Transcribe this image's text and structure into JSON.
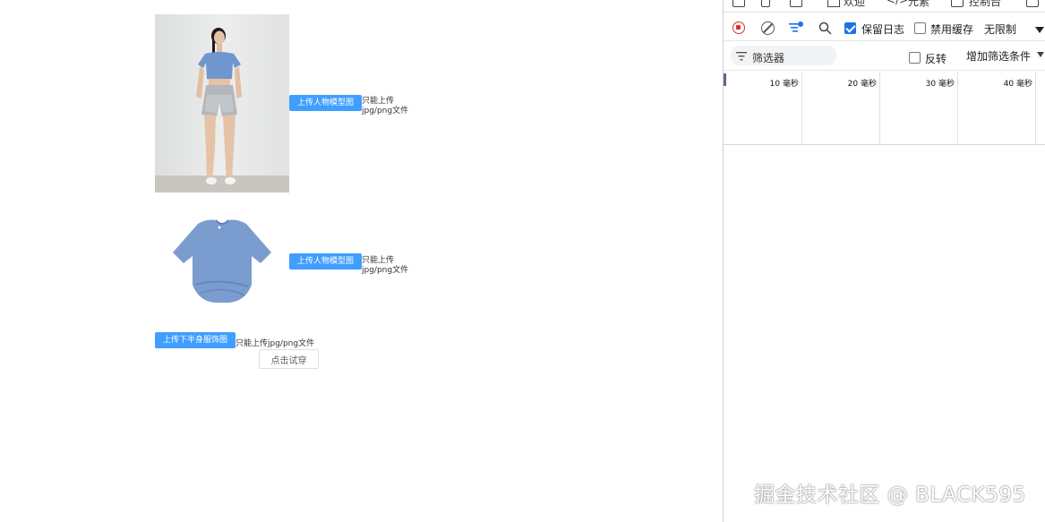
{
  "app": {
    "upload_model": {
      "button_label": "上传人物模型图",
      "tip_line1": "只能上传",
      "tip_line2": "jpg/png文件"
    },
    "upload_top": {
      "button_label": "上传人物模型图",
      "tip_line1": "只能上传",
      "tip_line2": "jpg/png文件"
    },
    "upload_bottom": {
      "button_label": "上传下半身服饰图",
      "tip": "只能上传jpg/png文件"
    },
    "try_on_label": "点击试穿"
  },
  "devtools": {
    "tabs": [
      {
        "label": "欢迎",
        "icon": "home-icon"
      },
      {
        "label": "元素",
        "icon": "code-icon"
      },
      {
        "label": "控制台",
        "icon": "console-icon"
      }
    ],
    "toolbar": {
      "preserve_log": {
        "label": "保留日志",
        "checked": true
      },
      "disable_cache": {
        "label": "禁用缓存",
        "checked": false
      },
      "throttle": "无限制"
    },
    "filter": {
      "placeholder": "筛选器",
      "invert": {
        "label": "反转",
        "checked": false
      },
      "more_filters": "增加筛选条件"
    },
    "timeline": {
      "ticks": [
        "10 毫秒",
        "20 毫秒",
        "30 毫秒",
        "40 毫秒"
      ]
    }
  },
  "watermark": "掘金技术社区 @ BLACK595",
  "colors": {
    "primary_button": "#409eff",
    "record_red": "#d93025",
    "checkbox_blue": "#1a73e8",
    "tshirt_blue": "#7b9ccf"
  }
}
